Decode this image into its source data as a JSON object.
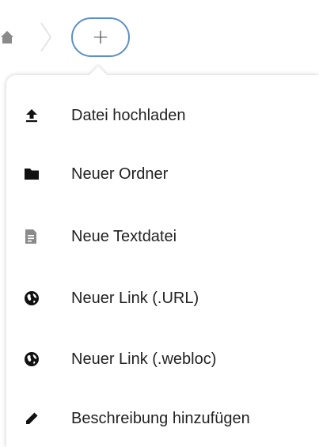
{
  "breadcrumb": {
    "home_icon": "home-icon",
    "add_button_label": "+"
  },
  "menu": {
    "items": [
      {
        "label": "Datei hochladen",
        "icon": "upload-icon"
      },
      {
        "label": "Neuer Ordner",
        "icon": "folder-icon"
      },
      {
        "label": "Neue Textdatei",
        "icon": "text-file-icon"
      },
      {
        "label": "Neuer Link (.URL)",
        "icon": "globe-icon"
      },
      {
        "label": "Neuer Link (.webloc)",
        "icon": "globe-icon"
      },
      {
        "label": "Beschreibung hinzufügen",
        "icon": "pencil-icon"
      }
    ]
  },
  "colors": {
    "accent_border": "#5c8fc6",
    "text": "#222222",
    "icon_dark": "#111111",
    "icon_muted": "#8a8a8a"
  }
}
